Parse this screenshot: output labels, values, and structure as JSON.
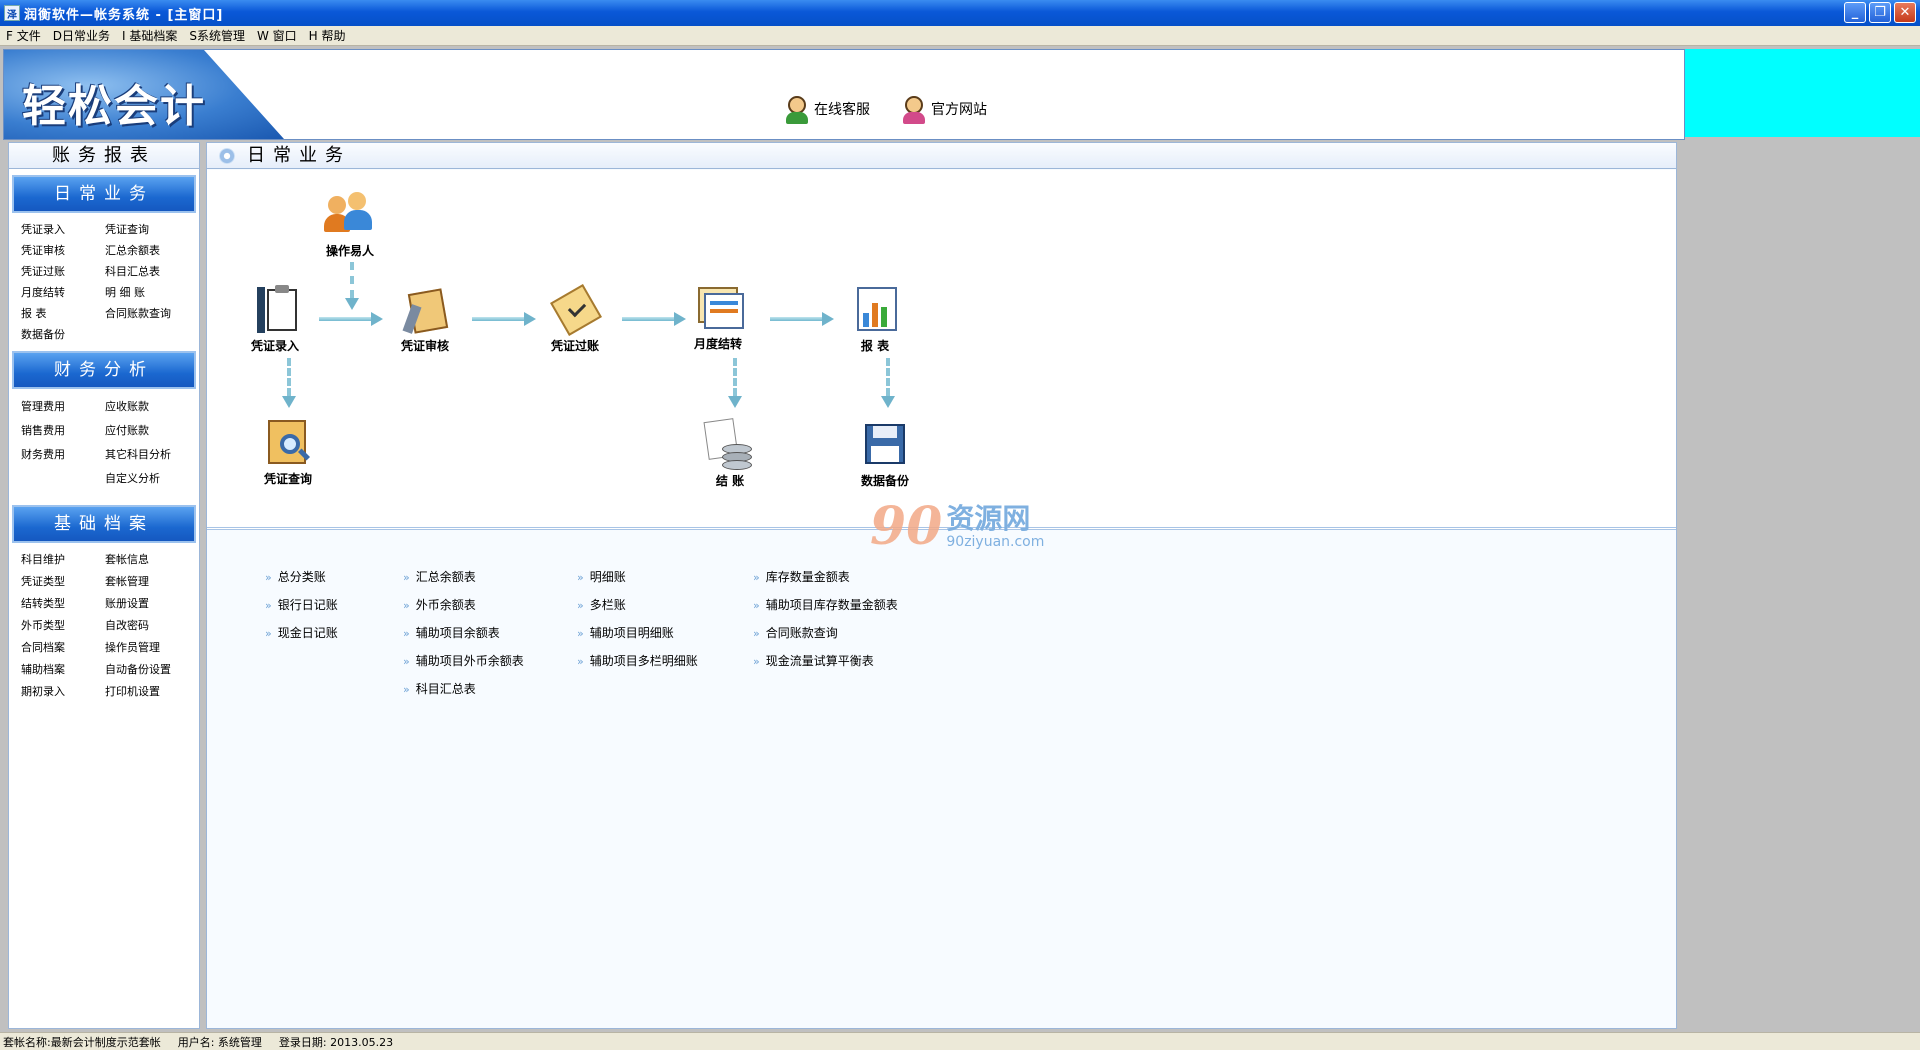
{
  "window": {
    "title": "润衡软件—帐务系统 - [主窗口]",
    "app_icon": "泽",
    "buttons": [
      "_",
      "❐",
      "✕"
    ]
  },
  "menu": [
    "F 文件",
    "D日常业务",
    "I 基础档案",
    "S系统管理",
    "W 窗口",
    "H 帮助"
  ],
  "banner": {
    "logo": "轻松会计",
    "online_service": "在线客服",
    "official_site": "官方网站"
  },
  "sidebar": {
    "title": "账务报表",
    "daily": {
      "header": "日常业务",
      "links": [
        "凭证录入",
        "凭证查询",
        "凭证审核",
        "汇总余额表",
        "凭证过账",
        "科目汇总表",
        "月度结转",
        "明  细  账",
        "报    表",
        "合同账款查询",
        "数据备份",
        ""
      ]
    },
    "analysis": {
      "header": "财务分析",
      "links": [
        "管理费用",
        "应收账款",
        "销售费用",
        "应付账款",
        "财务费用",
        "其它科目分析",
        "",
        "自定义分析"
      ]
    },
    "archive": {
      "header": "基础档案",
      "links": [
        "科目维护",
        "套帐信息",
        "凭证类型",
        "套帐管理",
        "结转类型",
        "账册设置",
        "外币类型",
        "自改密码",
        "合同档案",
        "操作员管理",
        "辅助档案",
        "自动备份设置",
        "期初录入",
        "打印机设置"
      ]
    }
  },
  "main": {
    "title": "日常业务",
    "flow": {
      "operator": "操作易人",
      "voucher_entry": "凭证录入",
      "voucher_audit": "凭证审核",
      "voucher_post": "凭证过账",
      "month_end": "月度结转",
      "report": "报  表",
      "voucher_query": "凭证查询",
      "closing": "结  账",
      "backup": "数据备份"
    },
    "reports": {
      "col1": [
        "总分类账",
        "银行日记账",
        "现金日记账"
      ],
      "col2": [
        "汇总余额表",
        "外币余额表",
        "辅助项目余额表",
        "辅助项目外币余额表",
        "科目汇总表"
      ],
      "col3": [
        "明细账",
        "多栏账",
        "辅助项目明细账",
        "辅助项目多栏明细账"
      ],
      "col4": [
        "库存数量金额表",
        "辅助项目库存数量金额表",
        "合同账款查询",
        "现金流量试算平衡表"
      ]
    }
  },
  "watermark": {
    "logo": "90",
    "cn": "资源网",
    "en": "90ziyuan.com"
  },
  "status": {
    "account": "套帐名称:最新会计制度示范套帐",
    "user": "用户名: 系统管理",
    "login_date": "登录日期: 2013.05.23"
  },
  "colors": {
    "titlebar": "#0a58d8",
    "accent_blue": "#1b68d0",
    "cyan_panel": "#00ffff",
    "arrow": "#6fb3cb"
  }
}
